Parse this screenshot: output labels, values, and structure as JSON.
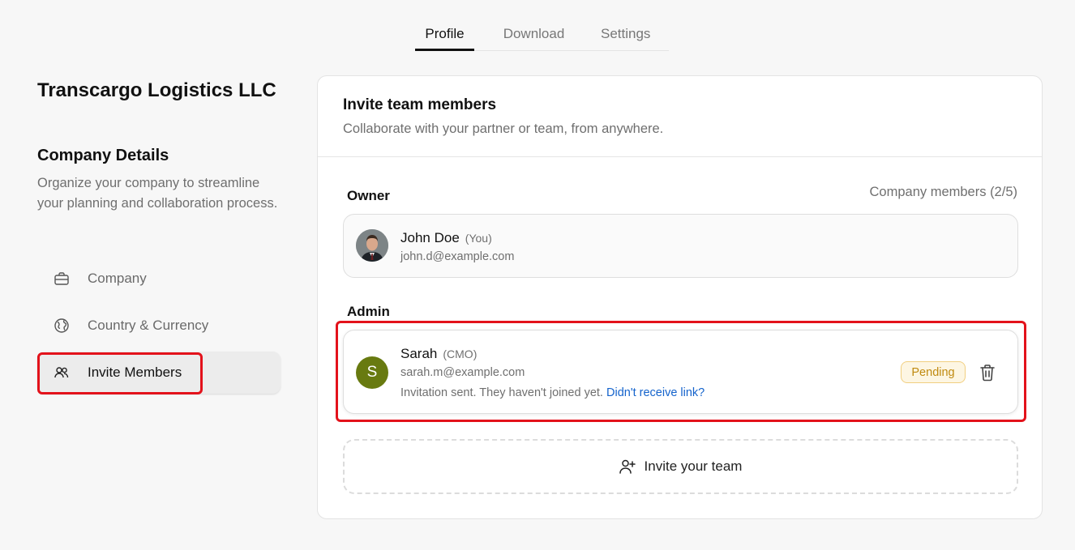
{
  "tabs": [
    {
      "label": "Profile",
      "active": true
    },
    {
      "label": "Download",
      "active": false
    },
    {
      "label": "Settings",
      "active": false
    }
  ],
  "company": {
    "name": "Transcargo Logistics LLC",
    "section_title": "Company Details",
    "section_description": "Organize your company to streamline your planning and collaboration process."
  },
  "nav": {
    "items": [
      {
        "label": "Company",
        "icon": "briefcase-icon",
        "active": false
      },
      {
        "label": "Country & Currency",
        "icon": "globe-icon",
        "active": false
      },
      {
        "label": "Invite Members",
        "icon": "users-icon",
        "active": true
      }
    ]
  },
  "card": {
    "title": "Invite team members",
    "subtitle": "Collaborate with your partner or team, from anywhere.",
    "owner_label": "Owner",
    "members_count": "Company members (2/5)",
    "admin_label": "Admin"
  },
  "owner": {
    "name": "John Doe",
    "role": "(You)",
    "email": "john.d@example.com",
    "avatar_kind": "photo"
  },
  "admin": {
    "initial": "S",
    "name": "Sarah",
    "role": "(CMO)",
    "email": "sarah.m@example.com",
    "note": "Invitation sent. They haven't joined yet.",
    "link": "Didn't receive link?",
    "status": "Pending",
    "avatar_color": "#687a10"
  },
  "invite_button": {
    "label": "Invite your team"
  },
  "colors": {
    "highlight": "#e3121b",
    "link": "#1463cc",
    "pending_text": "#c08a10",
    "pending_bg": "#fdf6e3"
  }
}
